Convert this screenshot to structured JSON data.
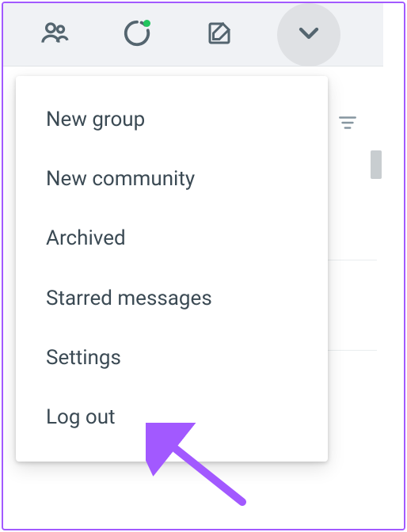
{
  "header": {
    "icons": {
      "community": "community-icon",
      "status": "status-icon",
      "compose": "compose-icon",
      "menu": "chevron-down-icon"
    }
  },
  "menu": {
    "items": [
      {
        "label": "New group"
      },
      {
        "label": "New community"
      },
      {
        "label": "Archived"
      },
      {
        "label": "Starred messages"
      },
      {
        "label": "Settings"
      },
      {
        "label": "Log out"
      }
    ]
  },
  "annotation": {
    "arrow_color": "#a259ff",
    "status_dot_color": "#22c55e"
  }
}
